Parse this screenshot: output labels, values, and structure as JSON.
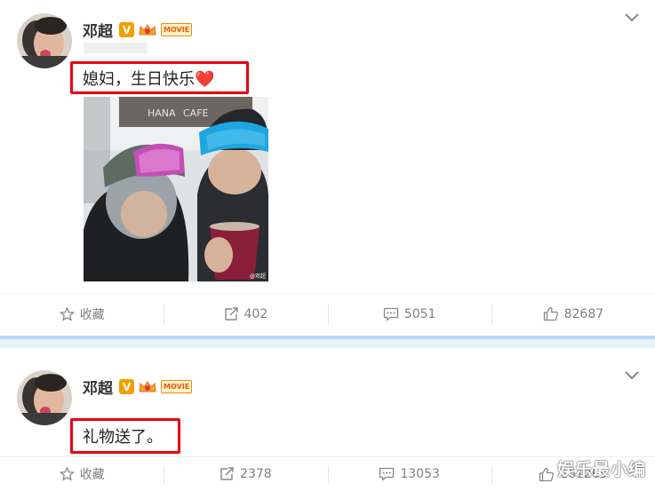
{
  "posts": [
    {
      "username": "邓超",
      "badges": {
        "verified": "V",
        "movie": "MOVIE"
      },
      "text": "媳妇，生日快乐❤️",
      "photo": {
        "sign1": "HANA",
        "sign2": "CAFE",
        "credit": "@邓超"
      },
      "actions": {
        "favorite_label": "收藏",
        "repost_count": "402",
        "comment_count": "5051",
        "like_count": "82687"
      }
    },
    {
      "username": "邓超",
      "badges": {
        "verified": "V",
        "movie": "MOVIE"
      },
      "text": "礼物送了。",
      "actions": {
        "favorite_label": "收藏",
        "repost_count": "2378",
        "comment_count": "13053",
        "like_count": "161263"
      }
    }
  ],
  "watermark": "娱乐最小编",
  "colors": {
    "highlight_border": "#e60012",
    "separator": "#b6dcf6",
    "action_text": "#808080"
  }
}
